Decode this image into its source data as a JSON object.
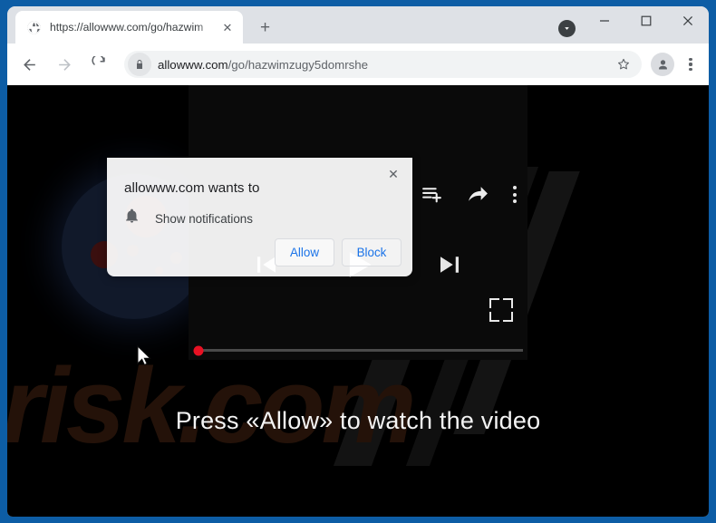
{
  "browser": {
    "tab": {
      "title": "https://allowww.com/go/hazwim",
      "favicon": "globe-icon",
      "close_label": "✕"
    },
    "new_tab_label": "+",
    "window_controls": {
      "minimize": "—",
      "maximize": "☐",
      "close": "✕",
      "download_indicator": "download-chevron-icon"
    },
    "toolbar": {
      "back": "back-arrow-icon",
      "forward": "forward-arrow-icon",
      "reload": "reload-icon",
      "lock": "lock-icon",
      "url_domain": "allowww.com",
      "url_path": "/go/hazwimzugy5domrshe",
      "bookmark": "star-icon",
      "profile": "account-avatar-icon",
      "menu": "three-dot-menu-icon"
    }
  },
  "permission_dialog": {
    "title": "allowww.com wants to",
    "permission_icon": "bell-icon",
    "permission_label": "Show notifications",
    "allow_label": "Allow",
    "block_label": "Block",
    "close_label": "✕",
    "accent_color": "#1a73e8"
  },
  "page": {
    "headline": "Press «Allow» to watch the video",
    "watermark": "risk.com",
    "watermark_color": "#241209",
    "background_color": "#000000",
    "player": {
      "play": "play-icon",
      "previous": "skip-previous-icon",
      "next": "skip-next-icon",
      "fullscreen": "fullscreen-icon",
      "add_to_playlist": "playlist-add-icon",
      "share": "share-icon",
      "more": "video-more-icon",
      "progress_percent": 0,
      "progress_knob_color": "#e81123"
    },
    "cursor": "mouse-pointer-icon"
  },
  "desktop": {
    "background_color": "#0d5da5"
  }
}
